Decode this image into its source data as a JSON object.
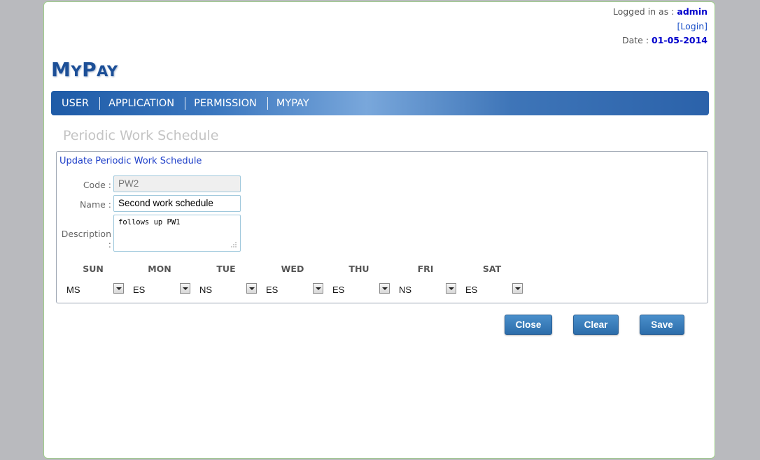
{
  "header": {
    "logged_in_label": "Logged in as :",
    "username": "admin",
    "login_link": "[Login]",
    "date_label": "Date :",
    "date_value": "01-05-2014"
  },
  "logo": {
    "first_big": "M",
    "first_small": "Y",
    "second_big": "P",
    "second_small": "AY"
  },
  "nav": [
    "USER",
    "APPLICATION",
    "PERMISSION",
    "MYPAY"
  ],
  "page_title": "Periodic Work Schedule",
  "panel": {
    "title": "Update Periodic Work Schedule",
    "code_label": "Code :",
    "code_value": "PW2",
    "name_label": "Name :",
    "name_value": "Second work schedule",
    "description_label": "Description :",
    "description_value": "follows up PW1"
  },
  "days": [
    {
      "name": "SUN",
      "value": "MS"
    },
    {
      "name": "MON",
      "value": "ES"
    },
    {
      "name": "TUE",
      "value": "NS"
    },
    {
      "name": "WED",
      "value": "ES"
    },
    {
      "name": "THU",
      "value": "ES"
    },
    {
      "name": "FRI",
      "value": "NS"
    },
    {
      "name": "SAT",
      "value": "ES"
    }
  ],
  "buttons": {
    "close": "Close",
    "clear": "Clear",
    "save": "Save"
  },
  "colors": {
    "nav_blue": "#2b62aa",
    "accent_blue": "#0000cc",
    "button_blue": "#3a7fbe"
  }
}
